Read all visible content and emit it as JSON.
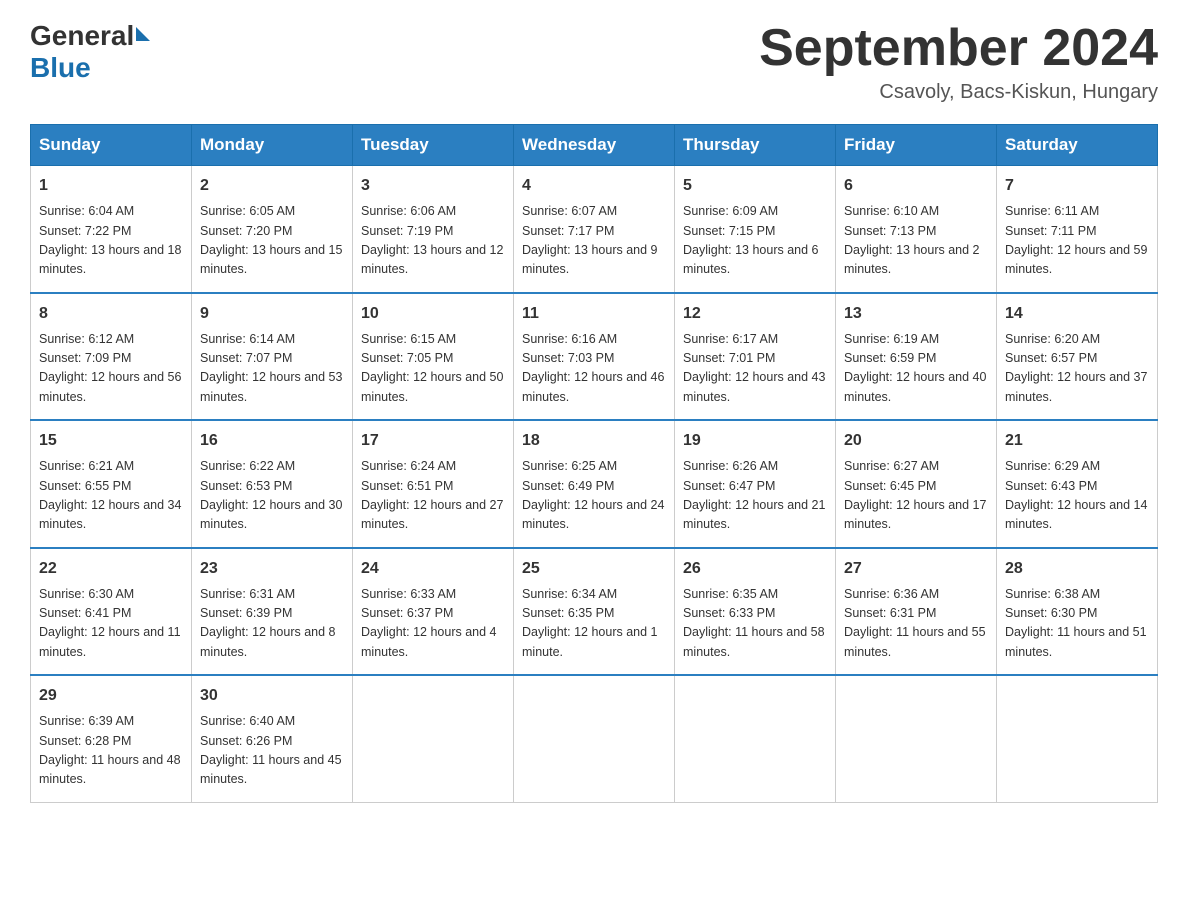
{
  "header": {
    "logo_general": "General",
    "logo_blue": "Blue",
    "title": "September 2024",
    "subtitle": "Csavoly, Bacs-Kiskun, Hungary"
  },
  "weekdays": [
    "Sunday",
    "Monday",
    "Tuesday",
    "Wednesday",
    "Thursday",
    "Friday",
    "Saturday"
  ],
  "weeks": [
    [
      {
        "day": "1",
        "sunrise": "6:04 AM",
        "sunset": "7:22 PM",
        "daylight": "13 hours and 18 minutes."
      },
      {
        "day": "2",
        "sunrise": "6:05 AM",
        "sunset": "7:20 PM",
        "daylight": "13 hours and 15 minutes."
      },
      {
        "day": "3",
        "sunrise": "6:06 AM",
        "sunset": "7:19 PM",
        "daylight": "13 hours and 12 minutes."
      },
      {
        "day": "4",
        "sunrise": "6:07 AM",
        "sunset": "7:17 PM",
        "daylight": "13 hours and 9 minutes."
      },
      {
        "day": "5",
        "sunrise": "6:09 AM",
        "sunset": "7:15 PM",
        "daylight": "13 hours and 6 minutes."
      },
      {
        "day": "6",
        "sunrise": "6:10 AM",
        "sunset": "7:13 PM",
        "daylight": "13 hours and 2 minutes."
      },
      {
        "day": "7",
        "sunrise": "6:11 AM",
        "sunset": "7:11 PM",
        "daylight": "12 hours and 59 minutes."
      }
    ],
    [
      {
        "day": "8",
        "sunrise": "6:12 AM",
        "sunset": "7:09 PM",
        "daylight": "12 hours and 56 minutes."
      },
      {
        "day": "9",
        "sunrise": "6:14 AM",
        "sunset": "7:07 PM",
        "daylight": "12 hours and 53 minutes."
      },
      {
        "day": "10",
        "sunrise": "6:15 AM",
        "sunset": "7:05 PM",
        "daylight": "12 hours and 50 minutes."
      },
      {
        "day": "11",
        "sunrise": "6:16 AM",
        "sunset": "7:03 PM",
        "daylight": "12 hours and 46 minutes."
      },
      {
        "day": "12",
        "sunrise": "6:17 AM",
        "sunset": "7:01 PM",
        "daylight": "12 hours and 43 minutes."
      },
      {
        "day": "13",
        "sunrise": "6:19 AM",
        "sunset": "6:59 PM",
        "daylight": "12 hours and 40 minutes."
      },
      {
        "day": "14",
        "sunrise": "6:20 AM",
        "sunset": "6:57 PM",
        "daylight": "12 hours and 37 minutes."
      }
    ],
    [
      {
        "day": "15",
        "sunrise": "6:21 AM",
        "sunset": "6:55 PM",
        "daylight": "12 hours and 34 minutes."
      },
      {
        "day": "16",
        "sunrise": "6:22 AM",
        "sunset": "6:53 PM",
        "daylight": "12 hours and 30 minutes."
      },
      {
        "day": "17",
        "sunrise": "6:24 AM",
        "sunset": "6:51 PM",
        "daylight": "12 hours and 27 minutes."
      },
      {
        "day": "18",
        "sunrise": "6:25 AM",
        "sunset": "6:49 PM",
        "daylight": "12 hours and 24 minutes."
      },
      {
        "day": "19",
        "sunrise": "6:26 AM",
        "sunset": "6:47 PM",
        "daylight": "12 hours and 21 minutes."
      },
      {
        "day": "20",
        "sunrise": "6:27 AM",
        "sunset": "6:45 PM",
        "daylight": "12 hours and 17 minutes."
      },
      {
        "day": "21",
        "sunrise": "6:29 AM",
        "sunset": "6:43 PM",
        "daylight": "12 hours and 14 minutes."
      }
    ],
    [
      {
        "day": "22",
        "sunrise": "6:30 AM",
        "sunset": "6:41 PM",
        "daylight": "12 hours and 11 minutes."
      },
      {
        "day": "23",
        "sunrise": "6:31 AM",
        "sunset": "6:39 PM",
        "daylight": "12 hours and 8 minutes."
      },
      {
        "day": "24",
        "sunrise": "6:33 AM",
        "sunset": "6:37 PM",
        "daylight": "12 hours and 4 minutes."
      },
      {
        "day": "25",
        "sunrise": "6:34 AM",
        "sunset": "6:35 PM",
        "daylight": "12 hours and 1 minute."
      },
      {
        "day": "26",
        "sunrise": "6:35 AM",
        "sunset": "6:33 PM",
        "daylight": "11 hours and 58 minutes."
      },
      {
        "day": "27",
        "sunrise": "6:36 AM",
        "sunset": "6:31 PM",
        "daylight": "11 hours and 55 minutes."
      },
      {
        "day": "28",
        "sunrise": "6:38 AM",
        "sunset": "6:30 PM",
        "daylight": "11 hours and 51 minutes."
      }
    ],
    [
      {
        "day": "29",
        "sunrise": "6:39 AM",
        "sunset": "6:28 PM",
        "daylight": "11 hours and 48 minutes."
      },
      {
        "day": "30",
        "sunrise": "6:40 AM",
        "sunset": "6:26 PM",
        "daylight": "11 hours and 45 minutes."
      },
      null,
      null,
      null,
      null,
      null
    ]
  ]
}
